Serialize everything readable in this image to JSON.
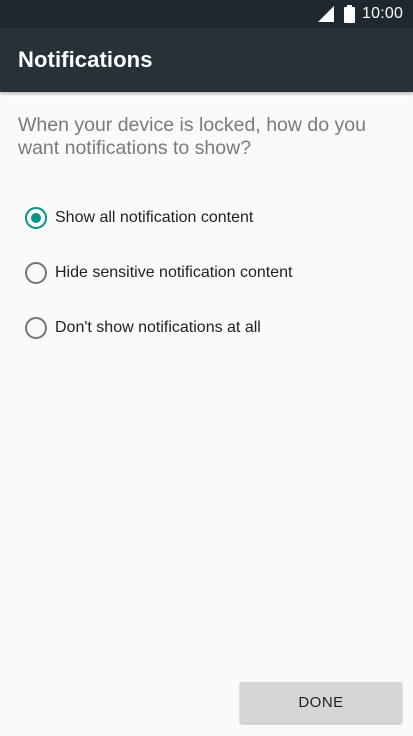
{
  "status_bar": {
    "time": "10:00",
    "icons": [
      "cellular-signal-icon",
      "battery-icon"
    ]
  },
  "app_bar": {
    "title": "Notifications"
  },
  "question": "When your device is locked, how do you want notifications to show?",
  "options": [
    {
      "label": "Show all notification content",
      "selected": true
    },
    {
      "label": "Hide sensitive notification content",
      "selected": false
    },
    {
      "label": "Don't show notifications at all",
      "selected": false
    }
  ],
  "done_label": "DONE",
  "colors": {
    "status_bar": "#1e282e",
    "app_bar": "#263238",
    "accent": "#009688",
    "background": "#fafafa",
    "button": "#d6d6d6"
  }
}
